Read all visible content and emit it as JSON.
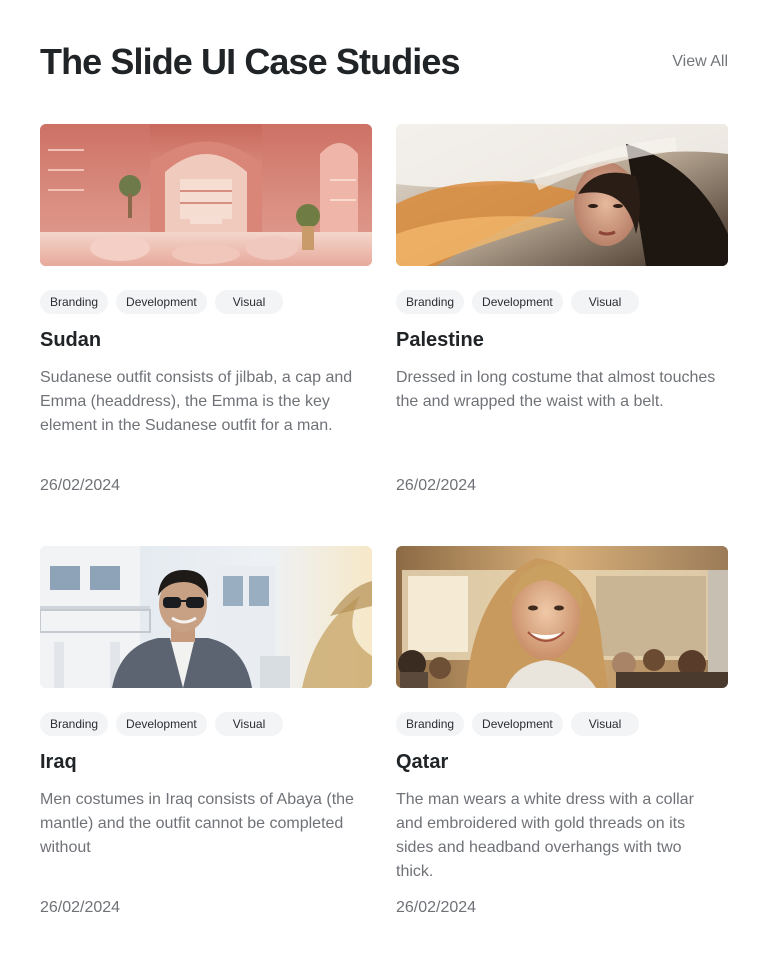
{
  "header": {
    "title": "The Slide UI Case Studies",
    "view_all": "View All"
  },
  "cards": [
    {
      "tags": [
        "Branding",
        "Development",
        "Visual"
      ],
      "title": "Sudan",
      "description": "Sudanese outfit consists of jilbab, a cap and Emma (headdress), the Emma is the key element in the Sudanese outfit for a man.",
      "date": "26/02/2024"
    },
    {
      "tags": [
        "Branding",
        "Development",
        "Visual"
      ],
      "title": "Palestine",
      "description": "Dressed in long costume that almost touches the and wrapped the waist with a belt.",
      "date": "26/02/2024"
    },
    {
      "tags": [
        "Branding",
        "Development",
        "Visual"
      ],
      "title": "Iraq",
      "description": "Men costumes in Iraq consists of Abaya (the mantle) and the outfit cannot be completed without",
      "date": "26/02/2024"
    },
    {
      "tags": [
        "Branding",
        "Development",
        "Visual"
      ],
      "title": "Qatar",
      "description": "The man wears a white dress with a collar and embroidered with gold threads on its sides and headband overhangs with two thick.",
      "date": "26/02/2024"
    }
  ]
}
